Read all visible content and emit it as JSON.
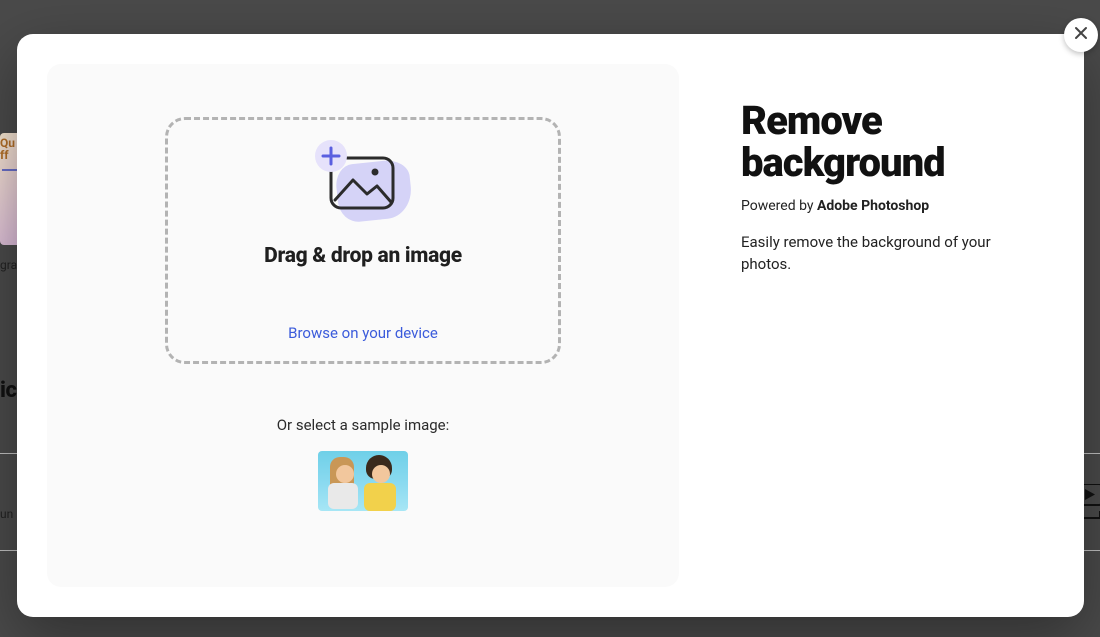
{
  "modal": {
    "title_line1": "Remove",
    "title_line2": "background",
    "powered_prefix": "Powered by ",
    "powered_brand": "Adobe Photoshop",
    "description": "Easily remove the background of your photos."
  },
  "dropzone": {
    "headline": "Drag & drop an image",
    "browse_label": "Browse on your device"
  },
  "samples": {
    "label": "Or select a sample image:"
  },
  "bg": {
    "card_word": "Qu",
    "card_word2": "ff",
    "label": "gra",
    "heading": "ic",
    "small": "un"
  },
  "icons": {
    "close": "close-icon",
    "plus": "plus-icon",
    "image": "image-icon",
    "youtube": "youtube-icon"
  }
}
